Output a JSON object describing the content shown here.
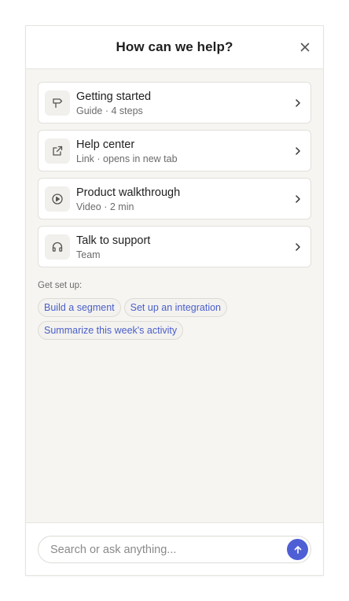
{
  "header": {
    "title": "How can we help?",
    "close_icon": "close-icon"
  },
  "cards": [
    {
      "icon": "signpost-icon",
      "title": "Getting started",
      "subtitle": "Guide · 4 steps"
    },
    {
      "icon": "external-link-icon",
      "title": "Help center",
      "subtitle": "Link · opens in new tab"
    },
    {
      "icon": "play-circle-icon",
      "title": "Product walkthrough",
      "subtitle": "Video · 2 min"
    },
    {
      "icon": "headphones-icon",
      "title": "Talk to support",
      "subtitle": "Team"
    }
  ],
  "setup": {
    "label": "Get set up:",
    "chips": [
      "Build a segment",
      "Set up an integration",
      "Summarize this week's activity"
    ]
  },
  "search": {
    "placeholder": "Search or ask anything...",
    "value": ""
  },
  "colors": {
    "accent": "#4e5fd6",
    "chip_text": "#4a5ec9",
    "panel_bg": "#f6f5f2",
    "card_bg": "#ffffff"
  }
}
